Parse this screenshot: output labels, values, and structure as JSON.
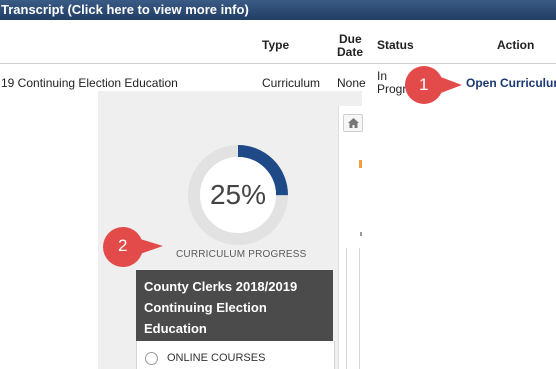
{
  "transcript": {
    "title": "Transcript (Click here to view more info)"
  },
  "table": {
    "headers": {
      "type": "Type",
      "due_line1": "Due",
      "due_line2": "Date",
      "status": "Status",
      "action": "Action"
    },
    "row": {
      "title": "19 Continuing Election Education",
      "type": "Curriculum",
      "due": "None",
      "status_line1": "In",
      "status_line2": "Progr",
      "action": "Open Curriculum"
    }
  },
  "curriculum": {
    "progress_percent": 25,
    "progress_text": "25%",
    "progress_label": "CURRICULUM PROGRESS",
    "title": "County Clerks 2018/2019 Continuing Election Education",
    "section_label": "ONLINE COURSES"
  },
  "callouts": [
    {
      "number": "1"
    },
    {
      "number": "2"
    }
  ],
  "colors": {
    "header_bar": "#2c4a73",
    "progress_arc": "#1f4a87",
    "progress_track": "#e2e2e2",
    "callout_red": "#e34a4a",
    "card_header": "#4b4b4b",
    "link": "#1a3970"
  }
}
